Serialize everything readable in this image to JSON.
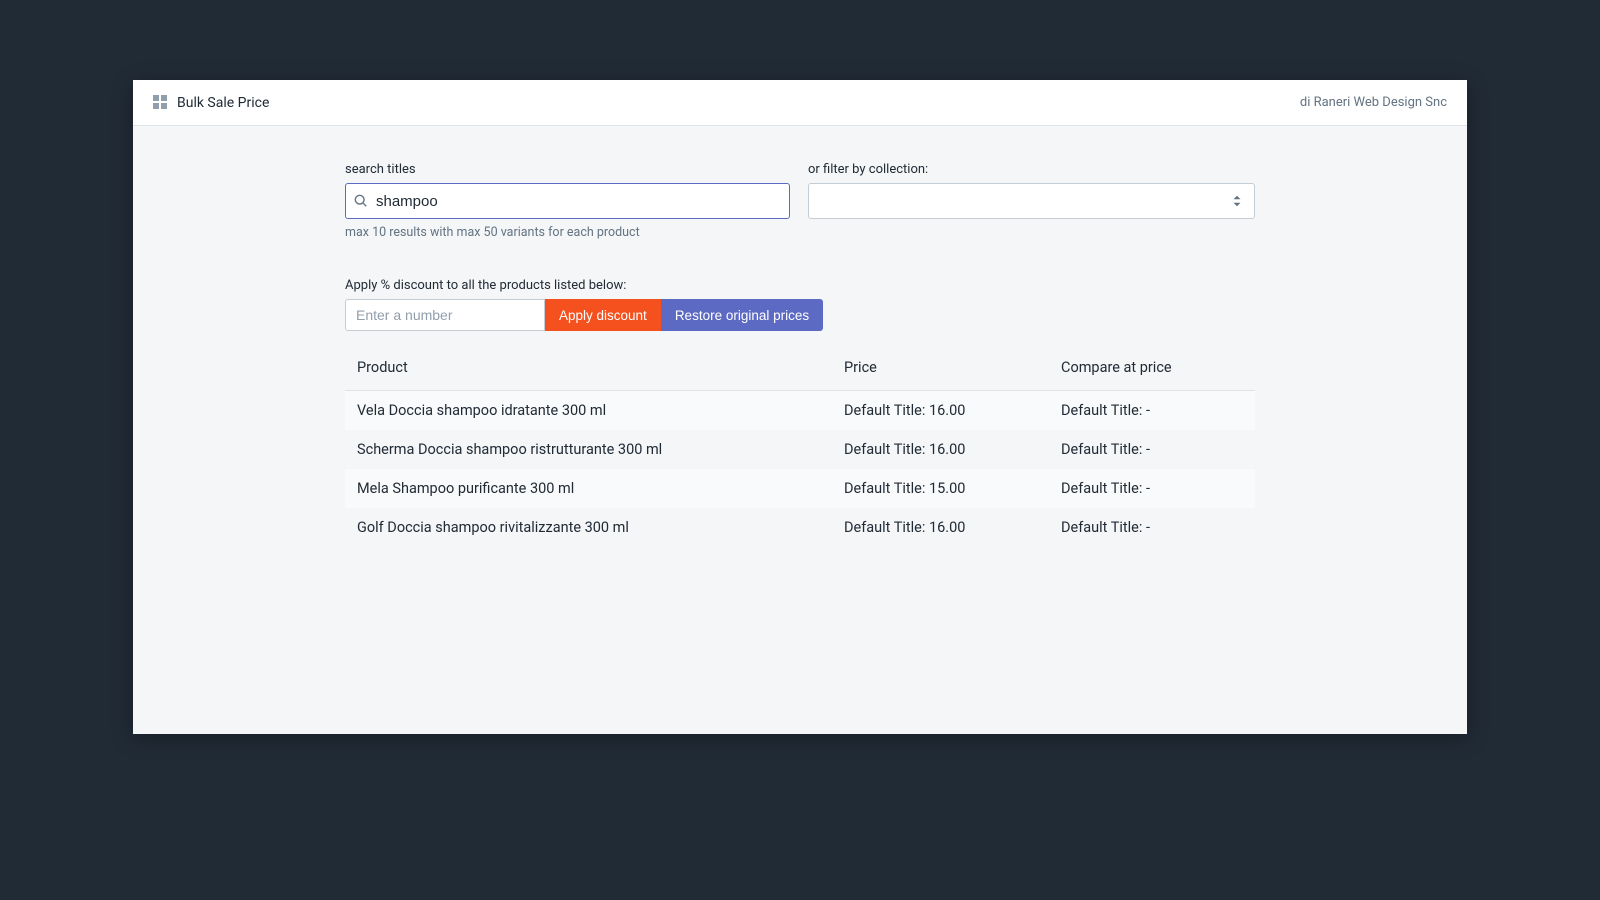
{
  "header": {
    "title": "Bulk Sale Price",
    "credit": "di Raneri Web Design Snc"
  },
  "filters": {
    "search_label": "search titles",
    "search_value": "shampoo",
    "search_help": "max 10 results with max 50 variants for each product",
    "collection_label": "or filter by collection:"
  },
  "discount": {
    "label": "Apply % discount to all the products listed below:",
    "number_placeholder": "Enter a number",
    "apply_label": "Apply discount",
    "restore_label": "Restore original prices"
  },
  "table": {
    "headers": {
      "product": "Product",
      "price": "Price",
      "compare": "Compare at price"
    },
    "rows": [
      {
        "product": "Vela Doccia shampoo idratante 300 ml",
        "price": "Default Title: 16.00",
        "compare": "Default Title: -"
      },
      {
        "product": "Scherma Doccia shampoo ristrutturante 300 ml",
        "price": "Default Title: 16.00",
        "compare": "Default Title: -"
      },
      {
        "product": "Mela Shampoo purificante 300 ml",
        "price": "Default Title: 15.00",
        "compare": "Default Title: -"
      },
      {
        "product": "Golf Doccia shampoo rivitalizzante 300 ml",
        "price": "Default Title: 16.00",
        "compare": "Default Title: -"
      }
    ]
  }
}
